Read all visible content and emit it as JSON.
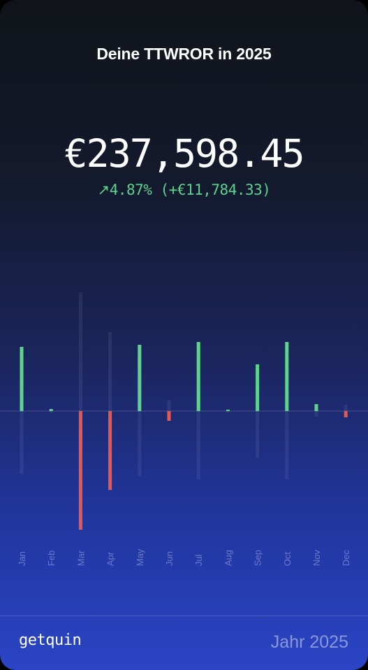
{
  "header": {
    "title": "Deine TTWROR in 2025"
  },
  "summary": {
    "amount": "€237,598.45",
    "arrow_icon": "arrow-up-right-icon",
    "change_text": "4.87% (+€11,784.33)"
  },
  "footer": {
    "brand": "getquin",
    "period": "Jahr 2025"
  },
  "colors": {
    "positive": "#5fd28e",
    "negative": "#e8574f",
    "range": "#ffffff"
  },
  "chart_data": {
    "type": "bar",
    "categories": [
      "Jan",
      "Feb",
      "Mar",
      "Apr",
      "May",
      "Jun",
      "Jul",
      "Aug",
      "Sep",
      "Oct",
      "Nov",
      "Dec"
    ],
    "values": [
      0.92,
      0.03,
      -1.7,
      -1.13,
      0.95,
      -0.14,
      0.99,
      0.02,
      0.67,
      0.99,
      0.1,
      -0.09
    ],
    "range_high": [
      0.72,
      0.02,
      1.7,
      1.13,
      0.92,
      0.16,
      0.92,
      0.02,
      0.6,
      0.92,
      0.06,
      0.09
    ],
    "range_low": [
      -0.9,
      -0.02,
      -1.05,
      -0.75,
      -0.93,
      -0.14,
      -0.98,
      -0.02,
      -0.67,
      -0.98,
      -0.08,
      -0.09
    ],
    "ylim": [
      -1.9,
      1.9
    ],
    "grid": false,
    "legend": "none"
  }
}
